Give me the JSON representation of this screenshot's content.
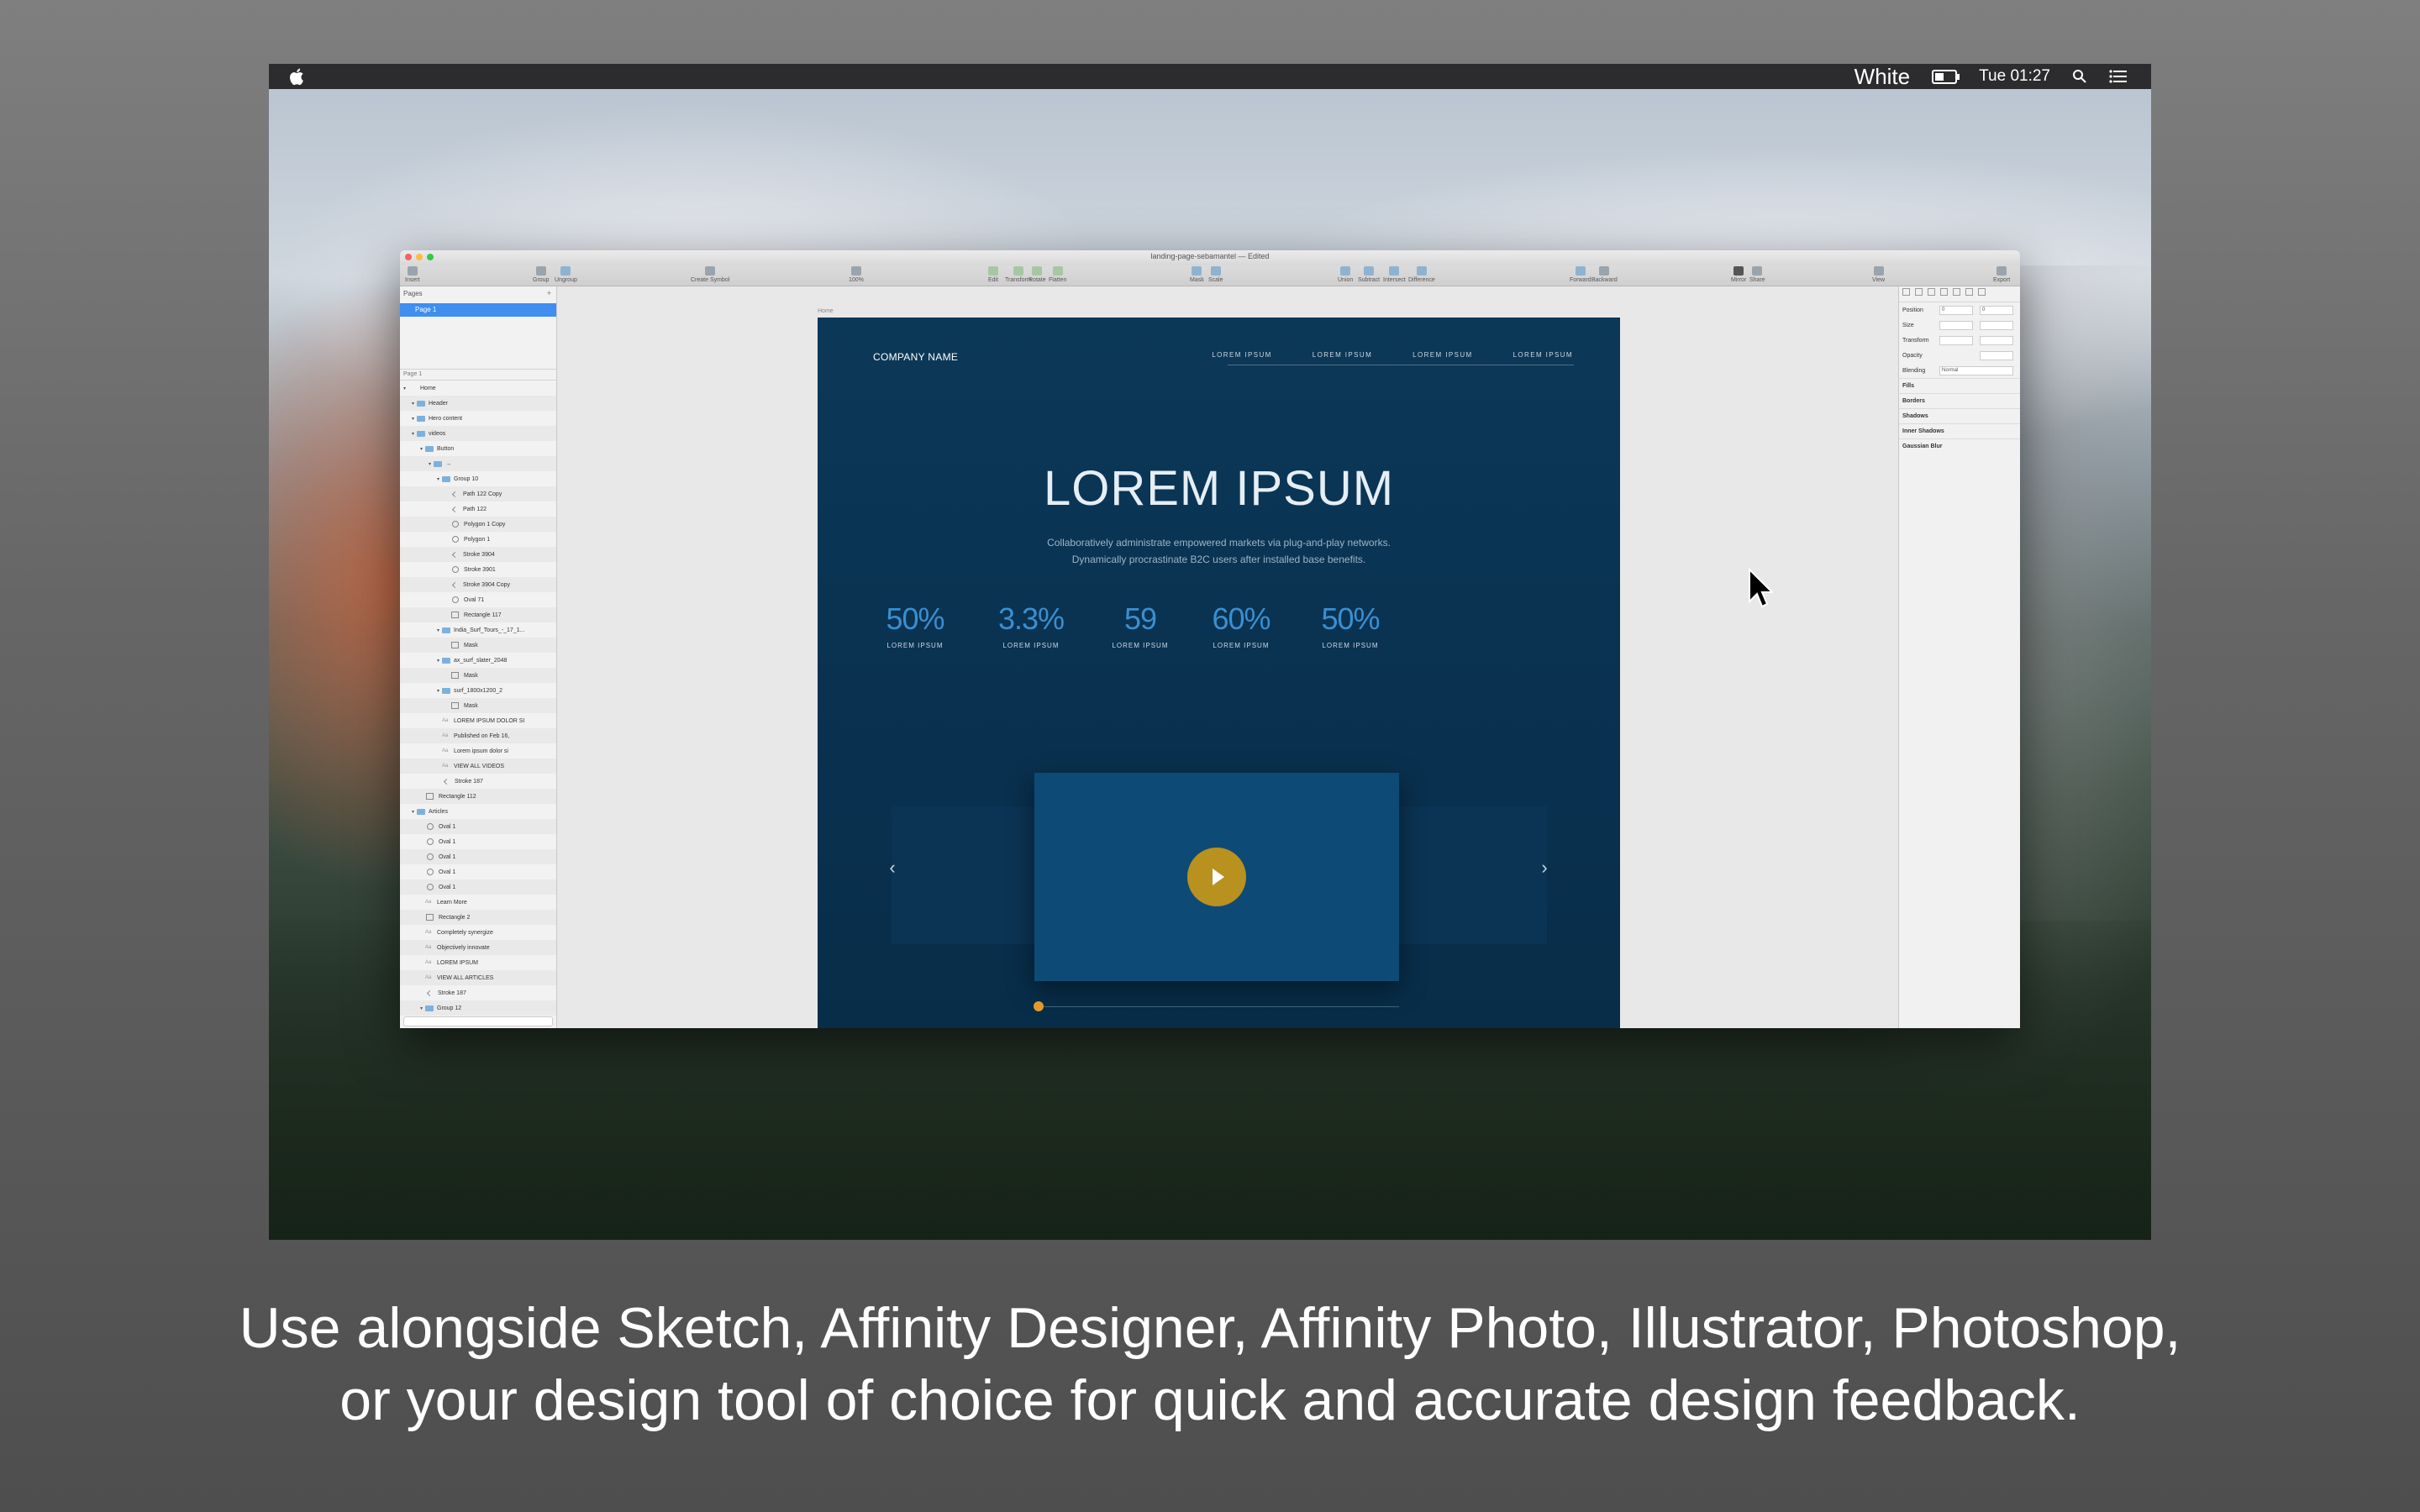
{
  "menubar": {
    "app_title": "White",
    "time": "Tue 01:27"
  },
  "window": {
    "title": "landing-page-sebamantel — Edited",
    "toolbar": {
      "insert": "Insert",
      "group": "Group",
      "ungroup": "Ungroup",
      "create_symbol": "Create Symbol",
      "zoom": "100%",
      "edit": "Edit",
      "transform": "Transform",
      "rotate": "Rotate",
      "flatten": "Flatten",
      "mask": "Mask",
      "scale": "Scale",
      "union": "Union",
      "subtract": "Subtract",
      "intersect": "Intersect",
      "difference": "Difference",
      "forward": "Forward",
      "backward": "Backward",
      "mirror": "Mirror",
      "share": "Share",
      "view": "View",
      "export": "Export"
    }
  },
  "left_panel": {
    "pages_header": "Pages",
    "page_selected": "Page 1",
    "layers_header": "Page 1",
    "layers": [
      {
        "name": "Home",
        "type": "artboard",
        "indent": 0
      },
      {
        "name": "Header",
        "type": "folder",
        "indent": 1
      },
      {
        "name": "Hero content",
        "type": "folder",
        "indent": 1
      },
      {
        "name": "videos",
        "type": "folder",
        "indent": 1
      },
      {
        "name": "Button",
        "type": "folder",
        "indent": 2
      },
      {
        "name": "→",
        "type": "folder",
        "indent": 3
      },
      {
        "name": "Group 10",
        "type": "folder",
        "indent": 4
      },
      {
        "name": "Path 122 Copy",
        "type": "path",
        "indent": 5
      },
      {
        "name": "Path 122",
        "type": "path",
        "indent": 5
      },
      {
        "name": "Polygon 1 Copy",
        "type": "shape",
        "indent": 5
      },
      {
        "name": "Polygon 1",
        "type": "shape",
        "indent": 5
      },
      {
        "name": "Stroke 3904",
        "type": "path",
        "indent": 5
      },
      {
        "name": "Stroke 3901",
        "type": "shape",
        "indent": 5
      },
      {
        "name": "Stroke 3904 Copy",
        "type": "path",
        "indent": 5
      },
      {
        "name": "Oval 71",
        "type": "shape",
        "indent": 5
      },
      {
        "name": "Rectangle 117",
        "type": "rect",
        "indent": 5
      },
      {
        "name": "India_Surf_Tours_-_17_1...",
        "type": "folder",
        "indent": 4
      },
      {
        "name": "Mask",
        "type": "rect",
        "indent": 5
      },
      {
        "name": "ax_surf_slater_2048",
        "type": "folder",
        "indent": 4
      },
      {
        "name": "Mask",
        "type": "rect",
        "indent": 5
      },
      {
        "name": "surf_1800x1200_2",
        "type": "folder",
        "indent": 4
      },
      {
        "name": "Mask",
        "type": "rect",
        "indent": 5
      },
      {
        "name": "LOREM IPSUM DOLOR SI",
        "type": "text",
        "indent": 4
      },
      {
        "name": "Published on Feb 16,",
        "type": "text",
        "indent": 4
      },
      {
        "name": "Lorem ipsum dolor si",
        "type": "text",
        "indent": 4
      },
      {
        "name": "VIEW ALL VIDEOS",
        "type": "text",
        "indent": 4
      },
      {
        "name": "Stroke 187",
        "type": "path",
        "indent": 4
      },
      {
        "name": "Rectangle 112",
        "type": "rect",
        "indent": 2
      },
      {
        "name": "Articles",
        "type": "folder",
        "indent": 1
      },
      {
        "name": "Oval 1",
        "type": "shape",
        "indent": 2
      },
      {
        "name": "Oval 1",
        "type": "shape",
        "indent": 2
      },
      {
        "name": "Oval 1",
        "type": "shape",
        "indent": 2
      },
      {
        "name": "Oval 1",
        "type": "shape",
        "indent": 2
      },
      {
        "name": "Oval 1",
        "type": "shape",
        "indent": 2
      },
      {
        "name": "Learn More",
        "type": "text",
        "indent": 2
      },
      {
        "name": "Rectangle 2",
        "type": "rect",
        "indent": 2
      },
      {
        "name": "Completely synergize",
        "type": "text",
        "indent": 2
      },
      {
        "name": "Objectively innovate",
        "type": "text",
        "indent": 2
      },
      {
        "name": "LOREM IPSUM",
        "type": "text",
        "indent": 2
      },
      {
        "name": "VIEW ALL ARTICLES",
        "type": "text",
        "indent": 2
      },
      {
        "name": "Stroke 187",
        "type": "path",
        "indent": 2
      },
      {
        "name": "Group 12",
        "type": "folder",
        "indent": 2
      }
    ]
  },
  "artboard": {
    "label": "Home",
    "company": "COMPANY NAME",
    "nav": [
      "LOREM IPSUM",
      "LOREM IPSUM",
      "LOREM IPSUM",
      "LOREM IPSUM"
    ],
    "hero_title": "LOREM IPSUM",
    "hero_sub_line1": "Collaboratively administrate empowered markets via plug-and-play networks.",
    "hero_sub_line2": "Dynamically procrastinate B2C users after installed base benefits.",
    "stats": [
      {
        "value": "50%",
        "label": "LOREM IPSUM"
      },
      {
        "value": "3.3%",
        "label": "LOREM IPSUM"
      },
      {
        "value": "59",
        "label": "LOREM IPSUM"
      },
      {
        "value": "60%",
        "label": "LOREM IPSUM"
      },
      {
        "value": "50%",
        "label": "LOREM IPSUM"
      }
    ],
    "accent_color": "#3a8fd0",
    "play_color": "#b8911f"
  },
  "inspector": {
    "position": "Position",
    "position_x": "0",
    "position_y": "0",
    "size": "Size",
    "transform": "Transform",
    "opacity": "Opacity",
    "blending": "Blending",
    "blending_value": "Normal",
    "sections": [
      "Fills",
      "Borders",
      "Shadows",
      "Inner Shadows",
      "Gaussian Blur"
    ]
  },
  "caption": {
    "line1": "Use alongside Sketch, Affinity Designer, Affinity Photo, Illustrator, Photoshop,",
    "line2": "or your design tool of choice for quick and accurate design feedback."
  }
}
